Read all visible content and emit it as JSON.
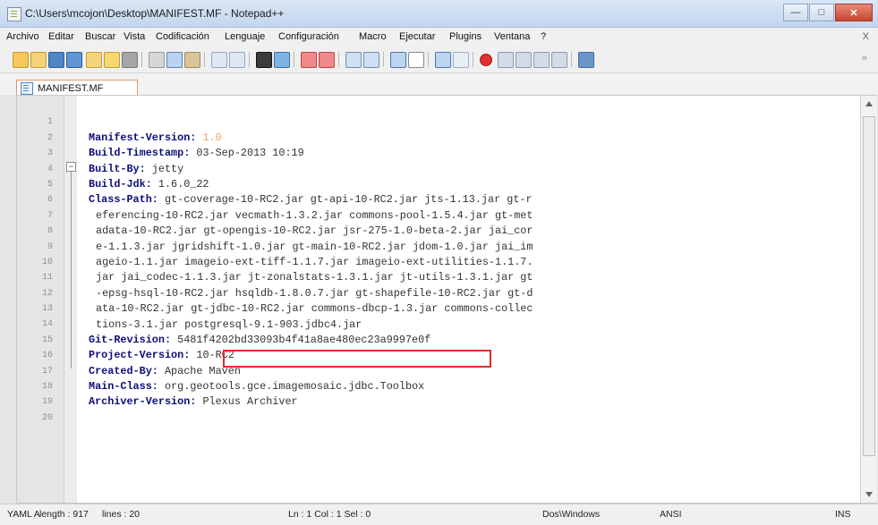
{
  "window": {
    "title": "C:\\Users\\mcojon\\Desktop\\MANIFEST.MF - Notepad++"
  },
  "menubar": {
    "items": [
      "Archivo",
      "Editar",
      "Buscar",
      "Vista",
      "Codificación",
      "Lenguaje",
      "Configuración",
      "Macro",
      "Ejecutar",
      "Plugins",
      "Ventana",
      "?"
    ],
    "close": "X"
  },
  "toolbar": {
    "more": "»"
  },
  "tab": {
    "label": "MANIFEST.MF"
  },
  "editor": {
    "lines": [
      {
        "num": "1",
        "key": "Manifest-Version:",
        "value": " 1.0"
      },
      {
        "num": "2",
        "key": "Build-Timestamp:",
        "value": " 03-Sep-2013 10:19"
      },
      {
        "num": "3",
        "key": "Built-By:",
        "value": " jetty"
      },
      {
        "num": "4",
        "key": "Build-Jdk:",
        "value": " 1.6.0_22"
      },
      {
        "num": "5",
        "key": "Class-Path:",
        "value": " gt-coverage-10-RC2.jar gt-api-10-RC2.jar jts-1.13.jar gt-r"
      },
      {
        "num": "6",
        "key": "",
        "value": "eferencing-10-RC2.jar vecmath-1.3.2.jar commons-pool-1.5.4.jar gt-met"
      },
      {
        "num": "7",
        "key": "",
        "value": "adata-10-RC2.jar gt-opengis-10-RC2.jar jsr-275-1.0-beta-2.jar jai_cor"
      },
      {
        "num": "8",
        "key": "",
        "value": "e-1.1.3.jar jgridshift-1.0.jar gt-main-10-RC2.jar jdom-1.0.jar jai_im"
      },
      {
        "num": "9",
        "key": "",
        "value": "ageio-1.1.jar imageio-ext-tiff-1.1.7.jar imageio-ext-utilities-1.1.7."
      },
      {
        "num": "10",
        "key": "",
        "value": "jar jai_codec-1.1.3.jar jt-zonalstats-1.3.1.jar jt-utils-1.3.1.jar gt"
      },
      {
        "num": "11",
        "key": "",
        "value": "-epsg-hsql-10-RC2.jar hsqldb-1.8.0.7.jar gt-shapefile-10-RC2.jar gt-d"
      },
      {
        "num": "12",
        "key": "",
        "value": "ata-10-RC2.jar gt-jdbc-10-RC2.jar commons-dbcp-1.3.jar commons-collec"
      },
      {
        "num": "13",
        "key": "",
        "value": "tions-3.1.jar postgresql-9.1-903.jdbc4.jar"
      },
      {
        "num": "14",
        "key": "Git-Revision:",
        "value": " 5481f4202bd33093b4f41a8ae480ec23a9997e0f"
      },
      {
        "num": "15",
        "key": "Project-Version:",
        "value": " 10-RC2"
      },
      {
        "num": "16",
        "key": "Created-By:",
        "value": " Apache Maven"
      },
      {
        "num": "17",
        "key": "Main-Class:",
        "value": " org.geotools.gce.imagemosaic.jdbc.Toolbox"
      },
      {
        "num": "18",
        "key": "Archiver-Version:",
        "value": " Plexus Archiver"
      },
      {
        "num": "19",
        "key": "",
        "value": ""
      },
      {
        "num": "20",
        "key": "",
        "value": ""
      }
    ],
    "highlighted_text": "postgresql-9.1-903.jdbc4.jar"
  },
  "statusbar": {
    "type": "YAML A",
    "length": "length : 917",
    "lines": "lines : 20",
    "position": "Ln : 1   Col : 1   Sel : 0",
    "eol": "Dos\\Windows",
    "encoding": "ANSI",
    "mode": "INS"
  },
  "colors": {
    "keyword": "#0d0d7a",
    "number": "#f0a36a",
    "highlight_box": "#e02b2b",
    "tab_border": "#d89b6a"
  }
}
